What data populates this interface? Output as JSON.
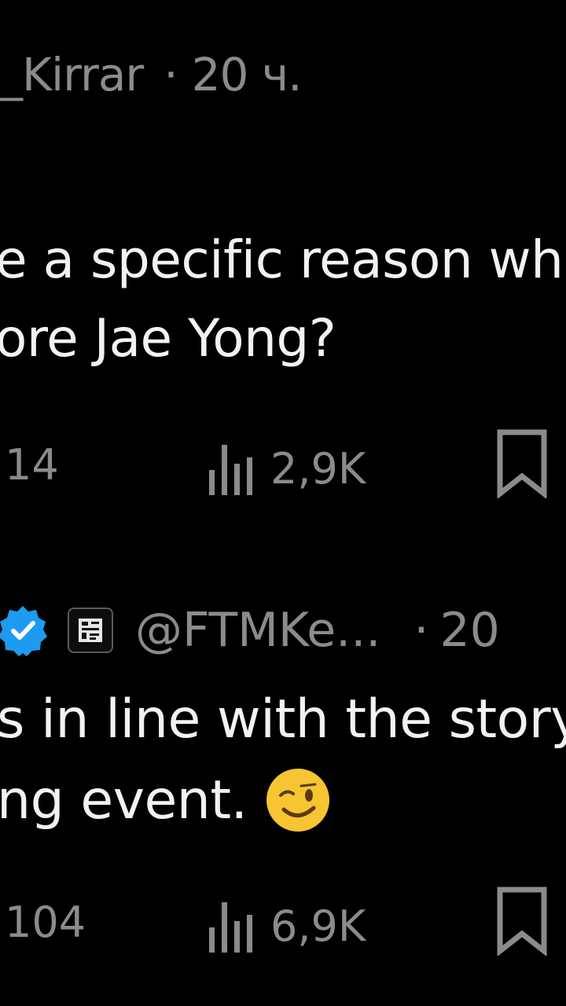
{
  "tweets": [
    {
      "author_partial": "_Kirrar",
      "separator": "·",
      "time": "20 ч.",
      "text_lines": [
        "e a specific reason wh",
        "ore Jae Yong?"
      ],
      "replies": "14",
      "views": "2,9K",
      "icons": [
        "views-icon",
        "bookmark-icon"
      ]
    },
    {
      "handle": "@FTMKe...",
      "separator": "·",
      "time_partial": "20",
      "verified": true,
      "text_lines": [
        "s in line with the story",
        "ng event."
      ],
      "emoji": "winking-face",
      "replies": "104",
      "views": "6,9K",
      "icons": [
        "verified-badge-icon",
        "affiliate-badge-icon",
        "winking-face-emoji",
        "views-icon",
        "bookmark-icon"
      ]
    }
  ],
  "colors": {
    "background": "#000000",
    "text": "#f2f2f2",
    "muted": "#8b8b8b",
    "verified_blue": "#1d9bf0",
    "emoji_yellow": "#f7c531"
  }
}
